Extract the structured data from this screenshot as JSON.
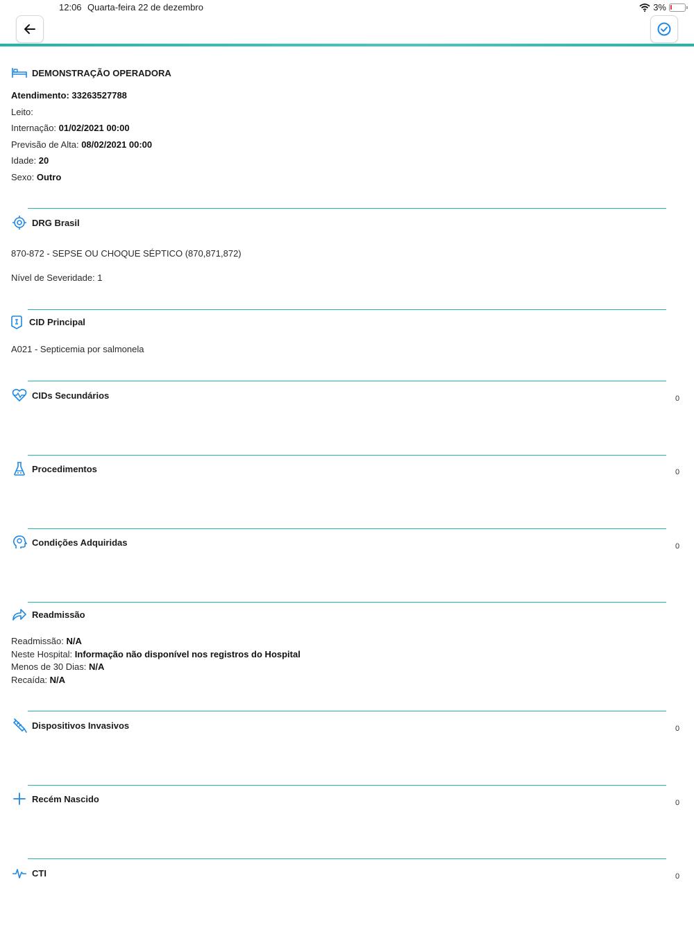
{
  "status_bar": {
    "time": "12:06",
    "date": "Quarta-feira 22 de dezembro",
    "battery": "3%"
  },
  "colors": {
    "accent": "#1e88e5",
    "divider": "#29b5ac"
  },
  "patient": {
    "title": "DEMONSTRAÇÃO OPERADORA",
    "atendimento": "Atendimento: 33263527788",
    "leito_label": "Leito:",
    "internacao_label": "Internação:",
    "internacao_value": "01/02/2021 00:00",
    "previsao_label": "Previsão de Alta:",
    "previsao_value": "08/02/2021 00:00",
    "idade_label": "Idade:",
    "idade_value": "20",
    "sexo_label": "Sexo:",
    "sexo_value": "Outro"
  },
  "drg": {
    "title": "DRG Brasil",
    "description": "870-872 - SEPSE OU CHOQUE SÉPTICO (870,871,872)",
    "severidade": "Nível de Severidade: 1"
  },
  "cid_principal": {
    "title": "CID Principal",
    "value": "A021 - Septicemia por salmonela"
  },
  "cids_secundarios": {
    "title": "CIDs Secundários",
    "count": "0"
  },
  "procedimentos": {
    "title": "Procedimentos",
    "count": "0"
  },
  "condicoes": {
    "title": "Condições Adquiridas",
    "count": "0"
  },
  "readmissao": {
    "title": "Readmissão",
    "readmissao_label": "Readmissão:",
    "readmissao_value": "N/A",
    "hospital_label": "Neste Hospital:",
    "hospital_value": "Informação não disponível nos registros do Hospital",
    "menos30_label": "Menos de 30 Dias:",
    "menos30_value": "N/A",
    "recaida_label": "Recaída:",
    "recaida_value": "N/A"
  },
  "dispositivos": {
    "title": "Dispositivos Invasivos",
    "count": "0"
  },
  "recem_nascido": {
    "title": "Recém Nascido",
    "count": "0"
  },
  "cti": {
    "title": "CTI",
    "count": "0"
  },
  "icons": [
    "back-arrow-icon",
    "check-circle-icon",
    "bed-icon",
    "target-icon",
    "clipboard-icon",
    "heart-pulse-icon",
    "flask-icon",
    "head-icon",
    "share-arrow-icon",
    "syringe-icon",
    "plus-icon",
    "pulse-icon",
    "wifi-icon",
    "battery-icon"
  ]
}
